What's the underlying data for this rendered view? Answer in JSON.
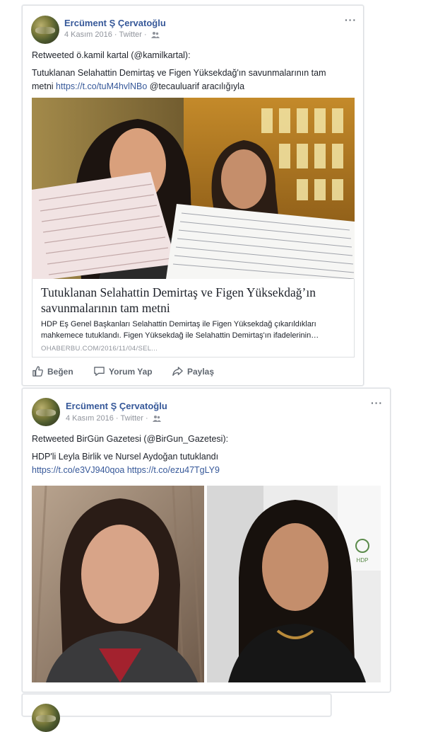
{
  "posts": [
    {
      "author": "Ercüment Ş Çervatoğlu",
      "date": "4 Kasım 2016",
      "source": "Twitter",
      "retweet_line": "Retweeted ö.kamil kartal (@kamilkartal):",
      "text_line1": "Tutuklanan Selahattin Demirtaş ve Figen Yüksekdağ'ın savunmalarının tam",
      "text_line2_prefix": "metni ",
      "text_link": "https://t.co/tuM4hvlNBo",
      "text_line2_suffix": " @tecauluarif aracılığıyla",
      "card": {
        "title_line1": "Tutuklanan Selahattin Demirtaş ve Figen Yüksekdağ’ın",
        "title_line2": "savunmalarının tam metni",
        "desc_line1": "HDP Eş Genel Başkanları Selahattin Demirtaş ile Figen Yüksekdağ çıkarıldıkları",
        "desc_line2": "mahkemece tutuklandı. Figen Yüksekdağ ile Selahattin Demirtaş'ın ifadelerinin…",
        "domain": "OHABERBU.COM/2016/11/04/SEL..."
      },
      "actions": {
        "like": "Beğen",
        "comment": "Yorum Yap",
        "share": "Paylaş"
      }
    },
    {
      "author": "Ercüment Ş Çervatoğlu",
      "date": "4 Kasım 2016",
      "source": "Twitter",
      "retweet_line": "Retweeted BirGün Gazetesi (@BirGun_Gazetesi):",
      "text_line1": "HDP'li Leyla Birlik ve Nursel Aydoğan tutuklandı",
      "link1": "https://t.co/e3VJ940qoa",
      "link2": "https://t.co/ezu47TgLY9"
    }
  ],
  "colors": {
    "link": "#365899",
    "meta": "#90949c",
    "border": "#dddfe2",
    "action": "#606770"
  }
}
